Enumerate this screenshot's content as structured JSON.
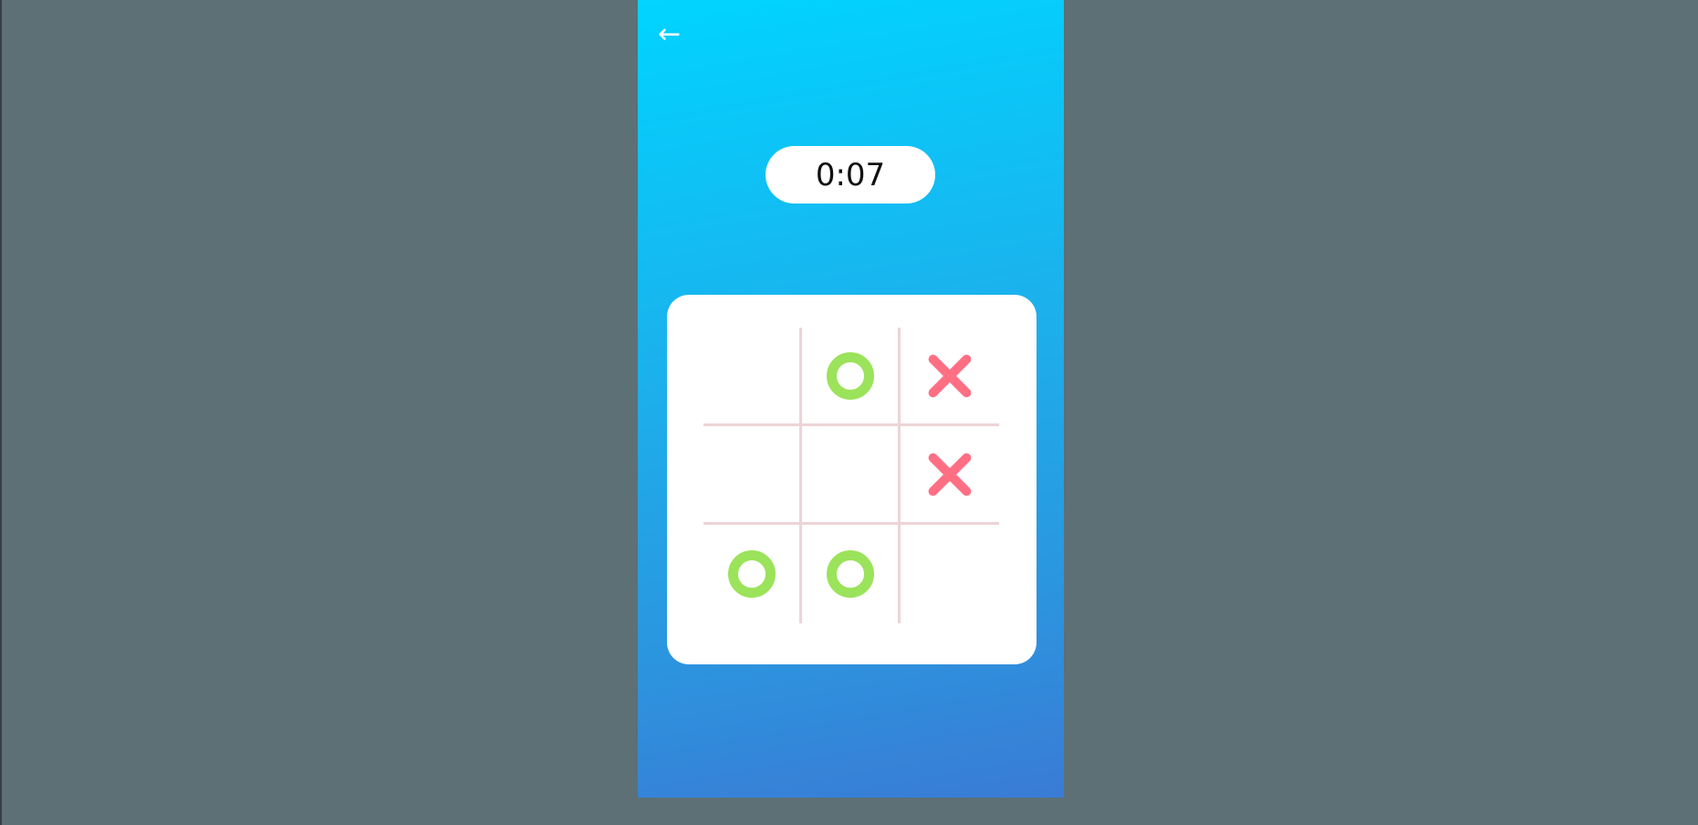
{
  "nav": {
    "back_icon": "←"
  },
  "timer": {
    "value": "0:07"
  },
  "board": {
    "cells": [
      "",
      "O",
      "X",
      "",
      "",
      "X",
      "O",
      "O",
      ""
    ]
  },
  "colors": {
    "background": "#5c7076",
    "gradient_top": "#00d4ff",
    "gradient_bottom": "#3a7bd5",
    "o_mark": "#9be35a",
    "x_mark": "#ff6f84",
    "grid_line": "#ecd4d6"
  }
}
